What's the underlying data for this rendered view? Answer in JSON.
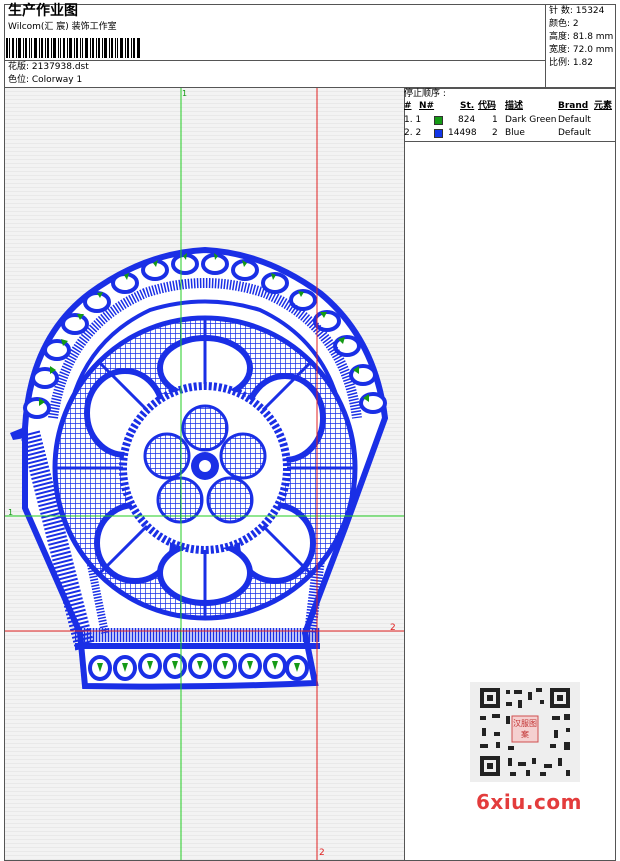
{
  "header": {
    "title": "生产作业图",
    "company": "Wilcom(汇 宸) 装饰工作室",
    "design_label": "花版: 2137938.dst",
    "colorway_label": "色位:  Colorway 1"
  },
  "stats": {
    "stitches": "针 ​​​​​​​数: 15324",
    "colors": "颜色: 2",
    "height": "高度: 81.8 mm",
    "width": "宽度: 72.0 mm",
    "scale": "比例: 1.82"
  },
  "stop_sequence": {
    "title": "停止顺序 :",
    "headers": [
      "#",
      "N#",
      "St.",
      "代码",
      "描述",
      "Brand",
      "元素"
    ],
    "rows": [
      {
        "num": "1. 1",
        "color": "#159a15",
        "stitches": "824",
        "code": "1",
        "desc": "Dark Green",
        "brand": "Default"
      },
      {
        "num": "2. 2",
        "color": "#1236e8",
        "stitches": "14498",
        "code": "2",
        "desc": "Blue",
        "brand": "Default"
      }
    ]
  },
  "guides": {
    "green_v_label": "1",
    "green_h_label": "1",
    "red_v_label": "2",
    "red_h_label": "2"
  },
  "watermark": {
    "text": "6xiu.com",
    "qr_center": "汉服图案"
  },
  "colors": {
    "stitch_blue": "#1a2fe6",
    "stitch_green": "#159a15",
    "guide_green": "#22cc22",
    "guide_red": "#e02020"
  }
}
